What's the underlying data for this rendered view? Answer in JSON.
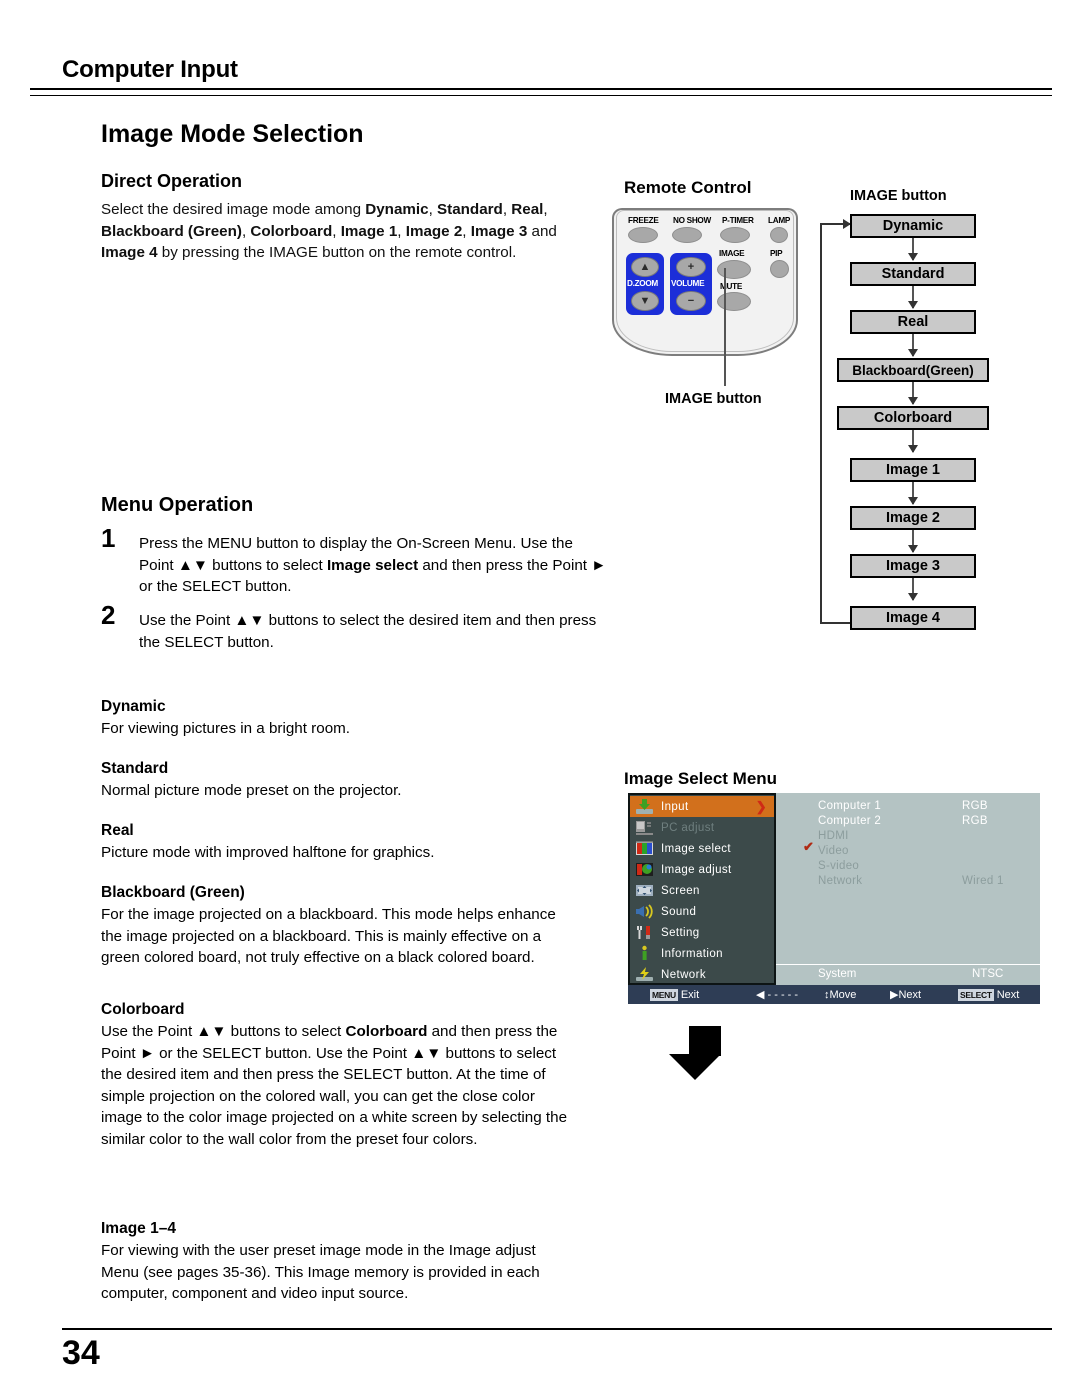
{
  "header": {
    "title": "Computer Input"
  },
  "page": {
    "title": "Image Mode Selection",
    "number": "34"
  },
  "direct_operation": {
    "heading": "Direct Operation",
    "body_prefix": "Select the desired image mode among ",
    "modes": [
      "Dynamic",
      "Standard",
      "Real",
      "Blackboard (Green)",
      "Colorboard",
      "Image 1",
      "Image 2",
      "Image 3",
      "Image 4"
    ],
    "body_suffix": " by pressing the IMAGE button on the remote control.",
    "full_text": "Select the desired image mode among Dynamic, Standard, Real, Blackboard (Green), Colorboard, Image 1, Image 2, Image 3 and Image 4 by pressing the IMAGE button on the remote control."
  },
  "menu_operation": {
    "heading": "Menu Operation",
    "steps": [
      {
        "number": "1",
        "text": "Press the MENU button to display the On-Screen Menu. Use the Point ▲▼ buttons to select Image select and then press the Point ► or the SELECT button.",
        "bold_term": "Image select"
      },
      {
        "number": "2",
        "text": "Use the Point ▲▼ buttons to select  the desired item and then press the SELECT button."
      }
    ]
  },
  "definitions": [
    {
      "term": "Dynamic",
      "desc": "For viewing pictures in a bright room."
    },
    {
      "term": "Standard",
      "desc": "Normal picture mode preset on the projector."
    },
    {
      "term": "Real",
      "desc": "Picture mode with improved halftone for graphics."
    },
    {
      "term": "Blackboard (Green)",
      "desc": "For the image projected on a blackboard. This mode helps enhance the image projected on a blackboard. This is mainly effective on a green colored board, not truly effective on a black colored board."
    },
    {
      "term": "Colorboard",
      "desc": "Use the Point ▲▼ buttons to select Colorboard and then press the Point ► or the SELECT button. Use the Point ▲▼ buttons to select the desired item and then press the SELECT button. At the time of simple projection on the colored wall, you can get the close color image to the color image projected on a white screen by selecting the similar color to the wall color from the preset four colors."
    },
    {
      "term": "Image 1–4",
      "desc": "For viewing with the user preset image mode in the Image adjust Menu (see pages 35-36). This Image memory is provided in each computer, component and video input source."
    }
  ],
  "remote": {
    "heading": "Remote Control",
    "callout_label": "IMAGE button",
    "buttons": [
      {
        "label": "FREEZE"
      },
      {
        "label": "NO SHOW"
      },
      {
        "label": "P-TIMER"
      },
      {
        "label": "LAMP"
      },
      {
        "label": "IMAGE"
      },
      {
        "label": "PIP"
      },
      {
        "label": "MUTE"
      },
      {
        "label": "D.ZOOM"
      },
      {
        "label": "VOLUME"
      }
    ],
    "dzoom_up": "▲",
    "dzoom_down": "▼",
    "volume_up": "+",
    "volume_down": "−"
  },
  "flowchart": {
    "callout_label": "IMAGE button",
    "nodes": [
      "Dynamic",
      "Standard",
      "Real",
      "Blackboard(Green)",
      "Colorboard",
      "Image 1",
      "Image 2",
      "Image 3",
      "Image 4"
    ]
  },
  "osd": {
    "heading": "Image Select Menu",
    "menu_items": [
      {
        "label": "Input",
        "icon": "input-icon",
        "state": "selected",
        "arrow": "❯"
      },
      {
        "label": "PC adjust",
        "icon": "pc-adjust-icon",
        "state": "dim"
      },
      {
        "label": "Image select",
        "icon": "image-select-icon",
        "state": "normal"
      },
      {
        "label": "Image adjust",
        "icon": "image-adjust-icon",
        "state": "normal"
      },
      {
        "label": "Screen",
        "icon": "screen-icon",
        "state": "normal"
      },
      {
        "label": "Sound",
        "icon": "sound-icon",
        "state": "normal"
      },
      {
        "label": "Setting",
        "icon": "setting-icon",
        "state": "normal"
      },
      {
        "label": "Information",
        "icon": "information-icon",
        "state": "normal"
      },
      {
        "label": "Network",
        "icon": "network-icon",
        "state": "normal"
      }
    ],
    "sources": [
      {
        "name": "Computer 1",
        "value": "RGB",
        "state": "bright",
        "checked": false
      },
      {
        "name": "Computer 2",
        "value": "RGB",
        "state": "bright",
        "checked": false
      },
      {
        "name": "HDMI",
        "value": "",
        "state": "faint",
        "checked": false
      },
      {
        "name": "Video",
        "value": "",
        "state": "faint",
        "checked": true
      },
      {
        "name": "S-video",
        "value": "",
        "state": "faint",
        "checked": false
      },
      {
        "name": "Network",
        "value": "Wired 1",
        "state": "faint",
        "checked": false
      }
    ],
    "system_label": "System",
    "system_value": "NTSC",
    "footer": [
      {
        "key": "MENU",
        "label": "Exit"
      },
      {
        "key": "",
        "label": "◀ - - - - -"
      },
      {
        "key": "",
        "label": "↕Move"
      },
      {
        "key": "",
        "label": "▶Next"
      },
      {
        "key": "SELECT",
        "label": "Next"
      }
    ]
  },
  "colors": {
    "osd_panel": "#3c4a4a",
    "osd_highlight": "#d2701c",
    "osd_right_panel": "#b4c3c3",
    "osd_footer": "#2e3d55",
    "remote_pad": "#1c2ed8",
    "flow_box": "#c9c9c9"
  }
}
